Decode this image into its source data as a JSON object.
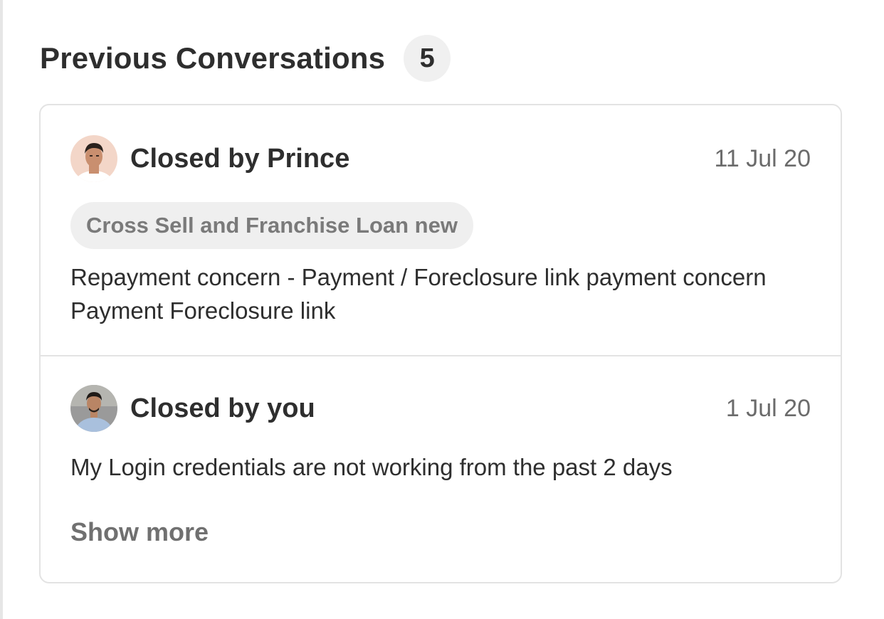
{
  "header": {
    "title": "Previous Conversations",
    "count": "5"
  },
  "conversations": [
    {
      "closed_by": "Closed by Prince",
      "date": "11 Jul 20",
      "tag": "Cross Sell and Franchise Loan new",
      "description": "Repayment concern - Payment / Foreclosure link payment concern Payment Foreclosure link",
      "avatar_icon": "person-avatar-icon"
    },
    {
      "closed_by": "Closed by you",
      "date": "1 Jul 20",
      "description": "My Login credentials are not working from the past 2 days",
      "avatar_icon": "person-avatar-icon"
    }
  ],
  "footer": {
    "show_more": "Show more"
  },
  "colors": {
    "title": "#2e2e2e",
    "muted": "#6b6b6b",
    "badge_bg": "#f0f0f0",
    "tag_bg": "#efefef",
    "border": "#e3e3e3"
  }
}
